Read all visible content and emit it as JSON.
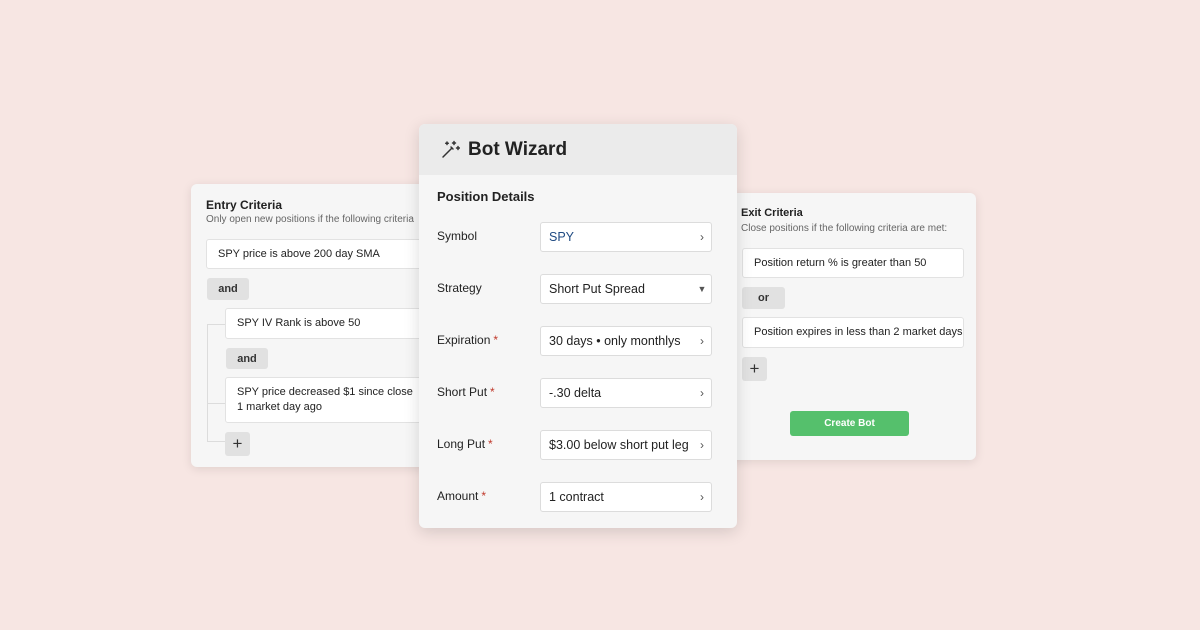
{
  "entry": {
    "title": "Entry Criteria",
    "subtitle": "Only open new positions if the following criteria",
    "criteria": [
      {
        "text": "SPY price is above 200 day SMA"
      },
      {
        "text": "SPY IV Rank is above 50"
      },
      {
        "line1": "SPY price decreased $1 since close",
        "line2": "1 market day ago"
      }
    ],
    "and_label_1": "and",
    "and_label_2": "and",
    "add_label": "+"
  },
  "wizard": {
    "title": "Bot Wizard",
    "section": "Position Details",
    "rows": [
      {
        "label": "Symbol",
        "required": false,
        "value": "SPY",
        "control": "chevron-right"
      },
      {
        "label": "Strategy",
        "required": false,
        "value": "Short Put Spread",
        "control": "caret-down"
      },
      {
        "label": "Expiration",
        "required": true,
        "value": "30 days • only monthlys",
        "control": "chevron-right"
      },
      {
        "label": "Short Put",
        "required": true,
        "value": "-.30 delta",
        "control": "chevron-right"
      },
      {
        "label": "Long Put",
        "required": true,
        "value": "$3.00 below short put leg",
        "control": "chevron-right"
      },
      {
        "label": "Amount",
        "required": true,
        "value": "1 contract",
        "control": "chevron-right"
      }
    ],
    "required_mark": "*"
  },
  "exit": {
    "title": "Exit Criteria",
    "subtitle": "Close positions if the following criteria are met:",
    "criteria": [
      {
        "text": "Position return % is greater than 50"
      },
      {
        "text": "Position expires in less than 2 market days"
      }
    ],
    "or_label": "or",
    "add_label": "+",
    "create_label": "Create Bot"
  },
  "colors": {
    "background": "#f7e6e3",
    "accent_green": "#55c06c",
    "required_red": "#c0392b",
    "symbol_blue": "#1f4a82"
  }
}
